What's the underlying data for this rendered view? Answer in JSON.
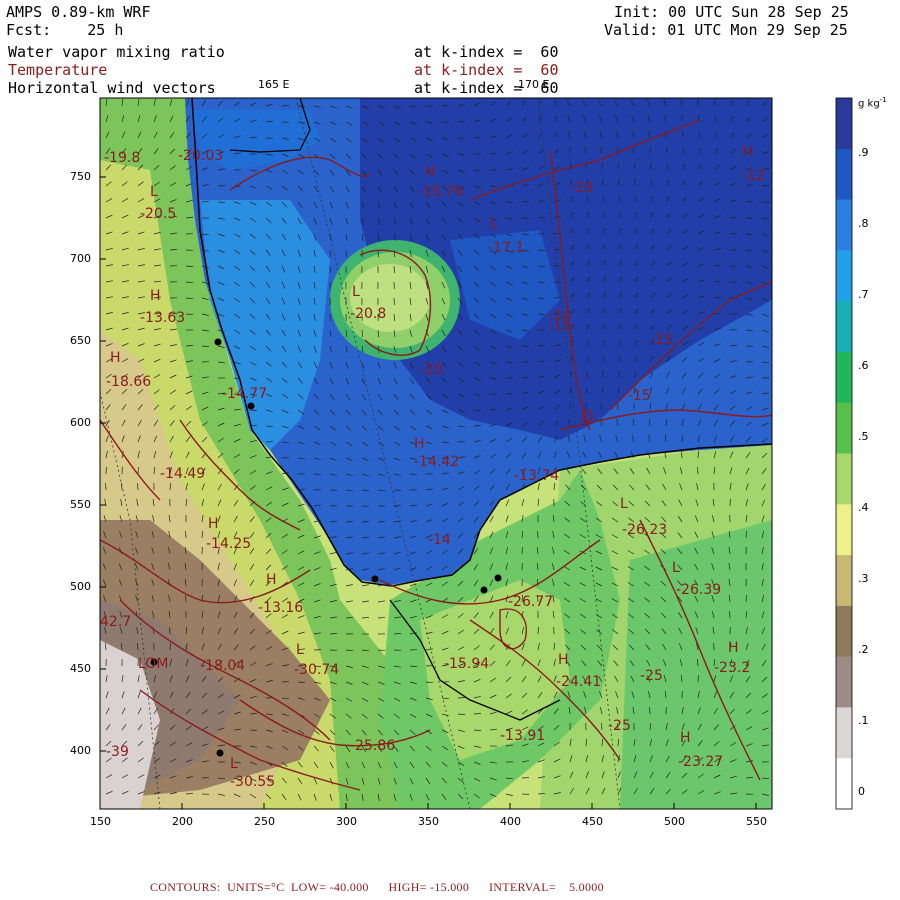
{
  "header": {
    "model": "AMPS 0.89-km WRF",
    "fcst_label": "Fcst:",
    "fcst_value": "25 h",
    "init": "Init: 00 UTC Sun 28 Sep 25",
    "valid": "Valid: 01 UTC Mon 29 Sep 25",
    "fields": [
      {
        "name": "Water vapor mixing ratio",
        "level": "at k-index =  60",
        "color": "#000000"
      },
      {
        "name": "Temperature",
        "level": "at k-index =  60",
        "color": "#8b1a1a"
      },
      {
        "name": "Horizontal wind vectors",
        "level": "at k-index =  60",
        "color": "#000000"
      }
    ]
  },
  "map": {
    "longitude_labels": [
      "165 E",
      "170 E"
    ],
    "x_ticks": [
      "150",
      "200",
      "250",
      "300",
      "350",
      "400",
      "450",
      "500",
      "550"
    ],
    "y_ticks": [
      "750",
      "700",
      "650",
      "600",
      "550",
      "500",
      "450",
      "400"
    ],
    "contour_labels": [
      {
        "text": "-19.8"
      },
      {
        "text": "-20.03"
      },
      {
        "text": "H"
      },
      {
        "text": "-15.76"
      },
      {
        "text": "H"
      },
      {
        "text": "-12"
      },
      {
        "text": "L"
      },
      {
        "text": "-20.5"
      },
      {
        "text": "-19"
      },
      {
        "text": "L"
      },
      {
        "text": "-17.1"
      },
      {
        "text": "-14"
      },
      {
        "text": "L"
      },
      {
        "text": "-20.8"
      },
      {
        "text": "H"
      },
      {
        "text": "-13.63"
      },
      {
        "text": "-15"
      },
      {
        "text": "-15"
      },
      {
        "text": "H"
      },
      {
        "text": "-18.66"
      },
      {
        "text": "-20"
      },
      {
        "text": "-14.77"
      },
      {
        "text": "-15"
      },
      {
        "text": "H"
      },
      {
        "text": "-14.42"
      },
      {
        "text": "-14.49"
      },
      {
        "text": "-13.74"
      },
      {
        "text": "L"
      },
      {
        "text": "-26.23"
      },
      {
        "text": "H"
      },
      {
        "text": "-14.25"
      },
      {
        "text": "L"
      },
      {
        "text": "-26.39"
      },
      {
        "text": "-14"
      },
      {
        "text": "H"
      },
      {
        "text": "-13.16"
      },
      {
        "text": "-26.77"
      },
      {
        "text": "42.7"
      },
      {
        "text": "L"
      },
      {
        "text": "-30.74"
      },
      {
        "text": "-18.04"
      },
      {
        "text": "-15.94"
      },
      {
        "text": "H"
      },
      {
        "text": "-24.41"
      },
      {
        "text": "-25"
      },
      {
        "text": "H"
      },
      {
        "text": "-23.2"
      },
      {
        "text": "-25.86"
      },
      {
        "text": "-13.91"
      },
      {
        "text": "-25"
      },
      {
        "text": "H"
      },
      {
        "text": "-23.27"
      },
      {
        "text": "-39"
      },
      {
        "text": "L"
      },
      {
        "text": "-30.55"
      },
      {
        "text": "LOM"
      }
    ]
  },
  "colorbar": {
    "unit": "g kg",
    "unit_exp": "-1",
    "labels": [
      ".9",
      ".8",
      ".7",
      ".6",
      ".5",
      ".4",
      ".3",
      ".2",
      ".1",
      "0"
    ],
    "colors": [
      "#2a3b9c",
      "#1f58c2",
      "#2a7fe0",
      "#1fa0e8",
      "#18b0b5",
      "#22b65a",
      "#56c04a",
      "#a6d86a",
      "#eef08c",
      "#c9b873",
      "#8e7a5c",
      "#9e8b86",
      "#ddd6d6",
      "#ffffff"
    ]
  },
  "footer": {
    "text": "CONTOURS:  UNITS=°C  LOW= -40.000      HIGH= -15.000      INTERVAL=    5.0000"
  }
}
